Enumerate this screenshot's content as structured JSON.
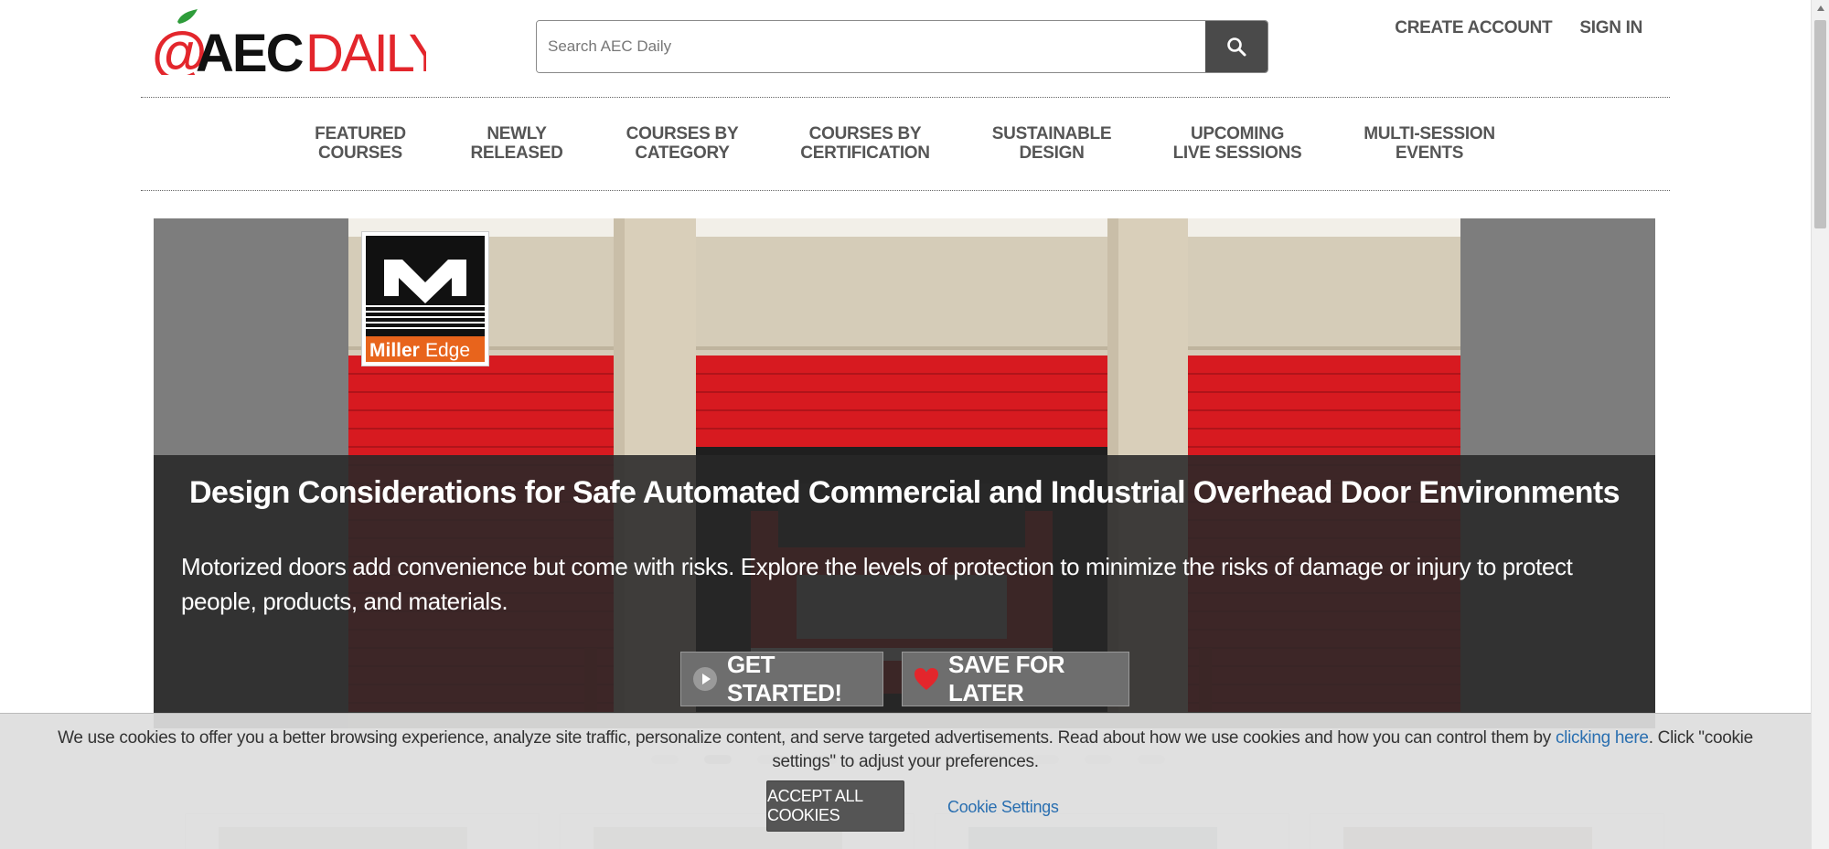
{
  "header": {
    "logo_text_prefix": "@",
    "logo_text_bold": "AEC",
    "logo_text_light": "DAILY",
    "search": {
      "placeholder": "Search AEC Daily",
      "value": ""
    },
    "links": [
      "CREATE ACCOUNT",
      "SIGN IN"
    ]
  },
  "nav": [
    {
      "line1": "FEATURED",
      "line2": "COURSES"
    },
    {
      "line1": "NEWLY",
      "line2": "RELEASED"
    },
    {
      "line1": "COURSES BY",
      "line2": "CATEGORY"
    },
    {
      "line1": "COURSES BY",
      "line2": "CERTIFICATION"
    },
    {
      "line1": "SUSTAINABLE",
      "line2": "DESIGN"
    },
    {
      "line1": "UPCOMING",
      "line2": "LIVE SESSIONS"
    },
    {
      "line1": "MULTI-SESSION",
      "line2": "EVENTS"
    }
  ],
  "hero": {
    "sponsor": {
      "name_part1": "Miller",
      "name_part2": "Edge"
    },
    "title": "Design Considerations for Safe Automated Commercial and Industrial Overhead Door Environments",
    "description": "Motorized doors add convenience but come with risks. Explore the levels of protection to minimize the risks of damage or injury to protect people, products, and materials.",
    "get_started_label": "GET STARTED!",
    "save_later_label": "SAVE FOR LATER"
  },
  "cookie_banner": {
    "icon": "info-icon",
    "text_before_link": " We use cookies to offer you a better browsing experience, analyze site traffic, personalize content, and serve targeted advertisements. Read about how we use cookies and how you can control them by ",
    "link_text": "clicking here",
    "text_after_link": ". Click \"cookie settings\" to adjust your preferences.",
    "accept_label": "ACCEPT ALL COOKIES",
    "settings_label": "Cookie Settings"
  },
  "colors": {
    "brand_red": "#e3262c",
    "nav_text": "#555555",
    "link_blue": "#2a6fb0",
    "hero_overlay": "#282828",
    "door_red": "#d71a20",
    "search_button": "#4a4a4a",
    "miller_orange": "#e8641c"
  }
}
